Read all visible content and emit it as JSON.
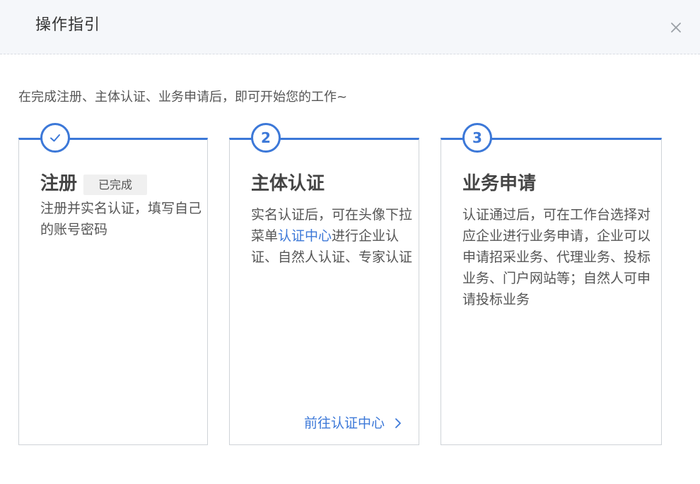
{
  "header": {
    "title": "操作指引"
  },
  "intro": "在完成注册、主体认证、业务申请后，即可开始您的工作~",
  "cards": [
    {
      "step": "",
      "status_icon": "check-icon",
      "title": "注册",
      "badge": "已完成",
      "desc": "注册并实名认证，填写自己的账号密码"
    },
    {
      "step": "2",
      "title": "主体认证",
      "desc_before": "实名认证后，可在头像下拉菜单",
      "desc_link": "认证中心",
      "desc_after": "进行企业认证、自然人认证、专家认证",
      "footer_link": "前往认证中心"
    },
    {
      "step": "3",
      "title": "业务申请",
      "desc": "认证通过后，可在工作台选择对应企业进行业务申请，企业可以申请招采业务、代理业务、投标业务、门户网站等；自然人可申请投标业务"
    }
  ],
  "colors": {
    "accent": "#3c78d8",
    "header_bg": "#f5f7fa",
    "badge_bg": "#f0f0f0"
  }
}
